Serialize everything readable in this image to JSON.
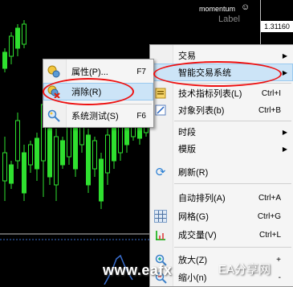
{
  "chart": {
    "indicator_label": "momentum",
    "label_text": "Label",
    "current_price": "1.31160"
  },
  "context_menu": {
    "items": [
      {
        "label": "交易",
        "shortcut": "",
        "has_submenu": true,
        "icon": ""
      },
      {
        "label": "智能交易系统",
        "shortcut": "",
        "has_submenu": true,
        "icon": "",
        "highlighted": true
      },
      {
        "label": "技术指标列表(L)",
        "shortcut": "Ctrl+I",
        "has_submenu": false,
        "icon": "indicator-list-icon"
      },
      {
        "label": "对象列表(b)",
        "shortcut": "Ctrl+B",
        "has_submenu": false,
        "icon": "object-list-icon"
      },
      {
        "label": "时段",
        "shortcut": "",
        "has_submenu": true,
        "icon": ""
      },
      {
        "label": "模版",
        "shortcut": "",
        "has_submenu": true,
        "icon": ""
      },
      {
        "label": "刷新(R)",
        "shortcut": "",
        "has_submenu": false,
        "icon": "refresh-icon"
      },
      {
        "label": "自动排列(A)",
        "shortcut": "Ctrl+A",
        "has_submenu": false,
        "icon": ""
      },
      {
        "label": "网格(G)",
        "shortcut": "Ctrl+G",
        "has_submenu": false,
        "icon": "grid-icon"
      },
      {
        "label": "成交量(V)",
        "shortcut": "Ctrl+L",
        "has_submenu": false,
        "icon": "volume-icon"
      },
      {
        "label": "放大(Z)",
        "shortcut": "+",
        "has_submenu": false,
        "icon": "zoom-in-icon"
      },
      {
        "label": "缩小(n)",
        "shortcut": "-",
        "has_submenu": false,
        "icon": "zoom-out-icon"
      }
    ]
  },
  "expert_submenu": {
    "items": [
      {
        "label": "属性(P)...",
        "shortcut": "F7",
        "icon": "properties-icon"
      },
      {
        "label": "消除(R)",
        "shortcut": "",
        "icon": "remove-expert-icon",
        "highlighted": true
      },
      {
        "label": "系统测试(S)",
        "shortcut": "F6",
        "icon": "tester-icon"
      }
    ]
  },
  "watermark": {
    "site": "www.eafx",
    "brand": "EA分享网"
  }
}
